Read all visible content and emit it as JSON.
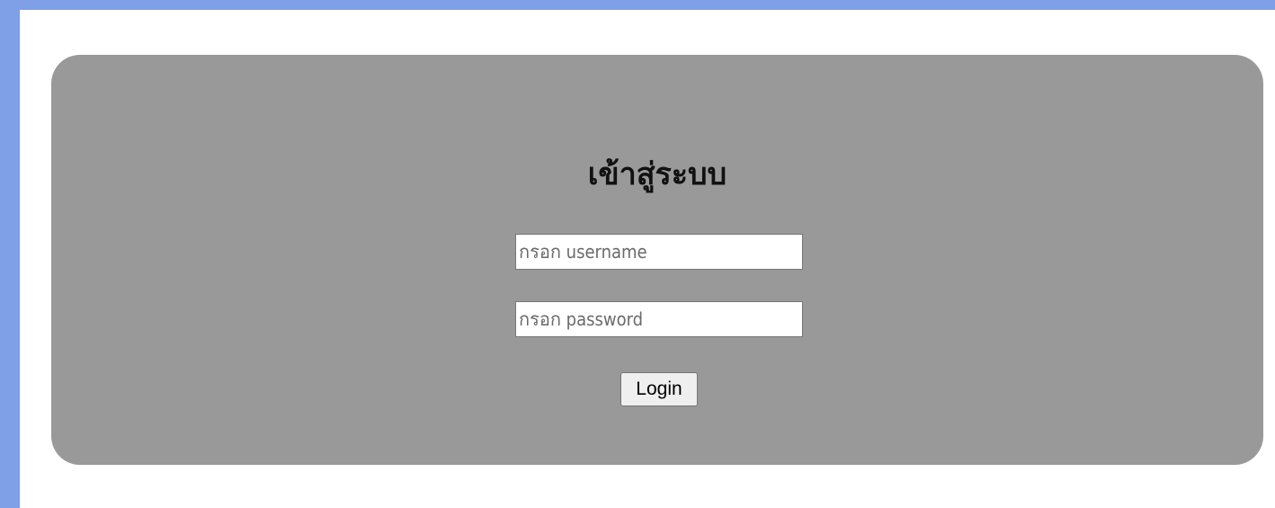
{
  "colors": {
    "frame": "#7f9fe6",
    "page_background": "#ffffff",
    "panel": "#999999",
    "button": "#efefef"
  },
  "login": {
    "title": "เข้าสู่ระบบ",
    "username": {
      "placeholder": "กรอก username",
      "value": ""
    },
    "password": {
      "placeholder": "กรอก password",
      "value": ""
    },
    "submit_label": "Login"
  }
}
